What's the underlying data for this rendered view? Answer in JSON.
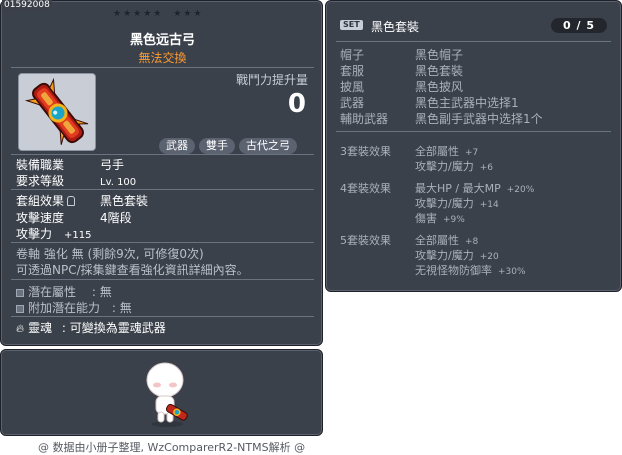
{
  "item_id": "01592008",
  "item": {
    "name": "黑色远古弓",
    "trade": "無法交換",
    "power_label": "戰鬥力提升量",
    "power_value": "0",
    "tags": [
      "武器",
      "雙手",
      "古代之弓"
    ],
    "stats": {
      "job_label": "裝備職業",
      "job_value": "弓手",
      "level_label": "要求等級",
      "level_value": "Lv. 100",
      "set_label": "套組效果",
      "set_value": "黑色套裝",
      "speed_label": "攻擊速度",
      "speed_value": "4階段",
      "attack_label": "攻擊力",
      "attack_value": "+115"
    },
    "scroll_line": "卷軸 強化 無 (剩餘9次, 可修復0次)",
    "hint_line": "可透過NPC/採集鍵查看強化資訊詳細內容。",
    "potential_label": "潛在屬性",
    "potential_value": ": 無",
    "addpotential_label": "附加潛在能力",
    "addpotential_value": ": 無",
    "soul_label": "靈魂",
    "soul_value": ": 可變換為靈魂武器"
  },
  "set": {
    "badge": "SET",
    "name": "黑色套裝",
    "count": "0 / 5",
    "parts": [
      {
        "k": "帽子",
        "v": "黑色帽子"
      },
      {
        "k": "套服",
        "v": "黑色套裝"
      },
      {
        "k": "披風",
        "v": "黑色披风"
      },
      {
        "k": "武器",
        "v": "黑色主武器中选择1"
      },
      {
        "k": "輔助武器",
        "v": "黑色副手武器中选择1个"
      }
    ],
    "effects": [
      {
        "label": "3套裝效果",
        "lines": [
          {
            "t": "全部屬性",
            "n": "+7"
          },
          {
            "t": "攻擊力/魔力",
            "n": "+6"
          }
        ]
      },
      {
        "label": "4套裝效果",
        "lines": [
          {
            "t": "最大HP / 最大MP",
            "n": "+20%"
          },
          {
            "t": "攻擊力/魔力",
            "n": "+14"
          },
          {
            "t": "傷害",
            "n": "+9%"
          }
        ]
      },
      {
        "label": "5套裝效果",
        "lines": [
          {
            "t": "全部屬性",
            "n": "+8"
          },
          {
            "t": "攻擊力/魔力",
            "n": "+20"
          },
          {
            "t": "无視怪物防御率",
            "n": "+30%"
          }
        ]
      }
    ]
  },
  "footer": "@ 数据由小册子整理, WzComparerR2-NTMS解析 @",
  "icons": {
    "item": "bow-item-icon",
    "character": "character-preview-icon"
  }
}
